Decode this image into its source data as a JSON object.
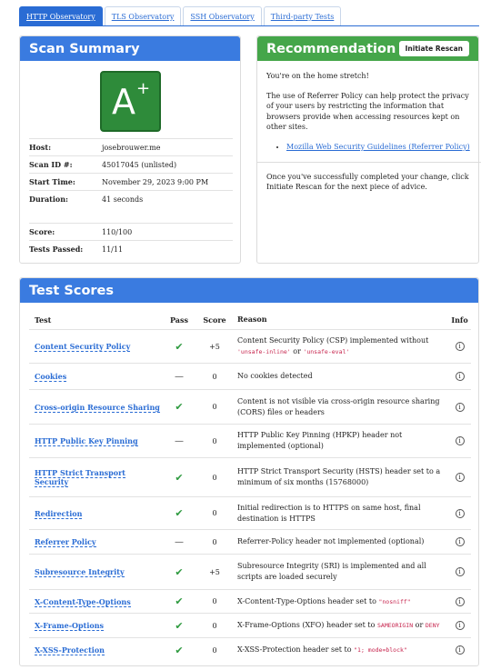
{
  "tabs": [
    {
      "label": "HTTP Observatory",
      "active": true
    },
    {
      "label": "TLS Observatory",
      "active": false
    },
    {
      "label": "SSH Observatory",
      "active": false
    },
    {
      "label": "Third-party Tests",
      "active": false
    }
  ],
  "summary": {
    "title": "Scan Summary",
    "grade": "A",
    "grade_modifier": "+",
    "rows": [
      {
        "key": "Host:",
        "value": "josebrouwer.me"
      },
      {
        "key": "Scan ID #:",
        "value": "45017045 (unlisted)"
      },
      {
        "key": "Start Time:",
        "value": "November 29, 2023 9:00 PM"
      },
      {
        "key": "Duration:",
        "value": "41 seconds"
      },
      {
        "key": "Score:",
        "value": "110/100"
      },
      {
        "key": "Tests Passed:",
        "value": "11/11"
      }
    ]
  },
  "recommendation": {
    "title": "Recommendation",
    "button_label": "Initiate Rescan",
    "p1": "You're on the home stretch!",
    "p2": "The use of Referrer Policy can help protect the privacy of your users by restricting the information that browsers provide when accessing resources kept on other sites.",
    "link": "Mozilla Web Security Guidelines (Referrer Policy)",
    "p3": "Once you've successfully completed your change, click Initiate Rescan for the next piece of advice."
  },
  "tests": {
    "title": "Test Scores",
    "headers": {
      "test": "Test",
      "pass": "Pass",
      "score": "Score",
      "reason": "Reason",
      "info": "Info"
    },
    "rows": [
      {
        "name": "Content Security Policy",
        "pass": "check",
        "score": "+5",
        "reason": "Content Security Policy (CSP) implemented without ",
        "code1": "'unsafe-inline'",
        "mid": " or ",
        "code2": "'unsafe-eval'",
        "tail": ""
      },
      {
        "name": "Cookies",
        "pass": "dash",
        "score": "0",
        "reason": "No cookies detected"
      },
      {
        "name": "Cross-origin Resource Sharing",
        "pass": "check",
        "score": "0",
        "reason": "Content is not visible via cross-origin resource sharing (CORS) files or headers"
      },
      {
        "name": "HTTP Public Key Pinning",
        "pass": "dash",
        "score": "0",
        "reason": "HTTP Public Key Pinning (HPKP) header not implemented (optional)"
      },
      {
        "name": "HTTP Strict Transport Security",
        "pass": "check",
        "score": "0",
        "reason": "HTTP Strict Transport Security (HSTS) header set to a minimum of six months (15768000)"
      },
      {
        "name": "Redirection",
        "pass": "check",
        "score": "0",
        "reason": "Initial redirection is to HTTPS on same host, final destination is HTTPS"
      },
      {
        "name": "Referrer Policy",
        "pass": "dash",
        "score": "0",
        "reason": "Referrer-Policy header not implemented (optional)"
      },
      {
        "name": "Subresource Integrity",
        "pass": "check",
        "score": "+5",
        "reason": "Subresource Integrity (SRI) is implemented and all scripts are loaded securely"
      },
      {
        "name": "X-Content-Type-Options",
        "pass": "check",
        "score": "0",
        "reason": "X-Content-Type-Options header set to ",
        "code1": "\"nosniff\"",
        "mid": "",
        "code2": "",
        "tail": ""
      },
      {
        "name": "X-Frame-Options",
        "pass": "check",
        "score": "0",
        "reason": "X-Frame-Options (XFO) header set to ",
        "code1": "SAMEORIGIN",
        "mid": " or ",
        "code2": "DENY",
        "tail": ""
      },
      {
        "name": "X-XSS-Protection",
        "pass": "check",
        "score": "0",
        "reason": "X-XSS-Protection header set to ",
        "code1": "\"1; mode=block\"",
        "mid": "",
        "code2": "",
        "tail": ""
      }
    ]
  }
}
